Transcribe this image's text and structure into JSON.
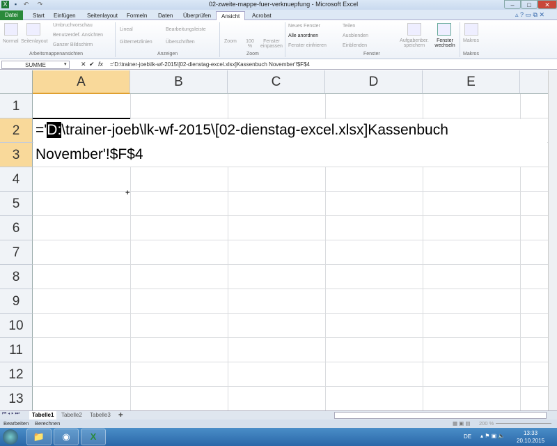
{
  "window": {
    "title": "02-zweite-mappe-fuer-verknuepfung - Microsoft Excel",
    "minimize": "–",
    "maximize": "□",
    "close": "✕"
  },
  "ribbon_tabs": [
    "Datei",
    "Start",
    "Einfügen",
    "Seitenlayout",
    "Formeln",
    "Daten",
    "Überprüfen",
    "Ansicht",
    "Acrobat"
  ],
  "ribbon": {
    "arbeitsmappen": {
      "normal": "Normal",
      "seitenlayout": "Seitenlayout",
      "umbruch": "Umbruchvorschau",
      "benutzer": "Benutzerdef. Ansichten",
      "ganzer": "Ganzer Bildschirm",
      "group": "Arbeitsmappenansichten"
    },
    "anzeigen": {
      "lineal": "Lineal",
      "gitter": "Gitternetzlinien",
      "bearbeitung": "Bearbeitungsleiste",
      "ueberschriften": "Überschriften",
      "group": "Anzeigen"
    },
    "zoom": {
      "zoom": "Zoom",
      "hundert": "100 %",
      "fenster": "Fenster einpassen",
      "group": "Zoom"
    },
    "fenster": {
      "neu": "Neues Fenster",
      "alle": "Alle anordnen",
      "einfrieren": "Fenster einfrieren",
      "teilen": "Teilen",
      "ausblenden": "Ausblenden",
      "einblenden": "Einblenden",
      "aufgaben": "Aufgabenber. speichern",
      "wechseln": "Fenster wechseln",
      "group": "Fenster"
    },
    "makros": {
      "makros": "Makros",
      "group": "Makros"
    }
  },
  "formula_bar": {
    "name_box": "SUMME",
    "cancel": "✕",
    "enter": "✔",
    "fx": "fx",
    "formula": "='D:\\trainer-joeb\\lk-wf-2015\\[02-dienstag-excel.xlsx]Kassenbuch November'!$F$4"
  },
  "columns": [
    "A",
    "B",
    "C",
    "D",
    "E"
  ],
  "rows": [
    "1",
    "2",
    "3",
    "4",
    "5",
    "6",
    "7",
    "8",
    "9",
    "10",
    "11",
    "12",
    "13"
  ],
  "cell_edit": {
    "line1_prefix": "='",
    "line1_highlight": "D:",
    "line1_rest": "\\trainer-joeb\\lk-wf-2015\\[02-dienstag-excel.xlsx]Kassenbuch",
    "line2": "November'!$F$4"
  },
  "sheets": [
    "Tabelle1",
    "Tabelle2",
    "Tabelle3"
  ],
  "status": {
    "mode1": "Bearbeiten",
    "mode2": "Berechnen",
    "zoom": "200 %"
  },
  "taskbar": {
    "lang": "DE",
    "time": "13:33",
    "date": "20.10.2015"
  }
}
